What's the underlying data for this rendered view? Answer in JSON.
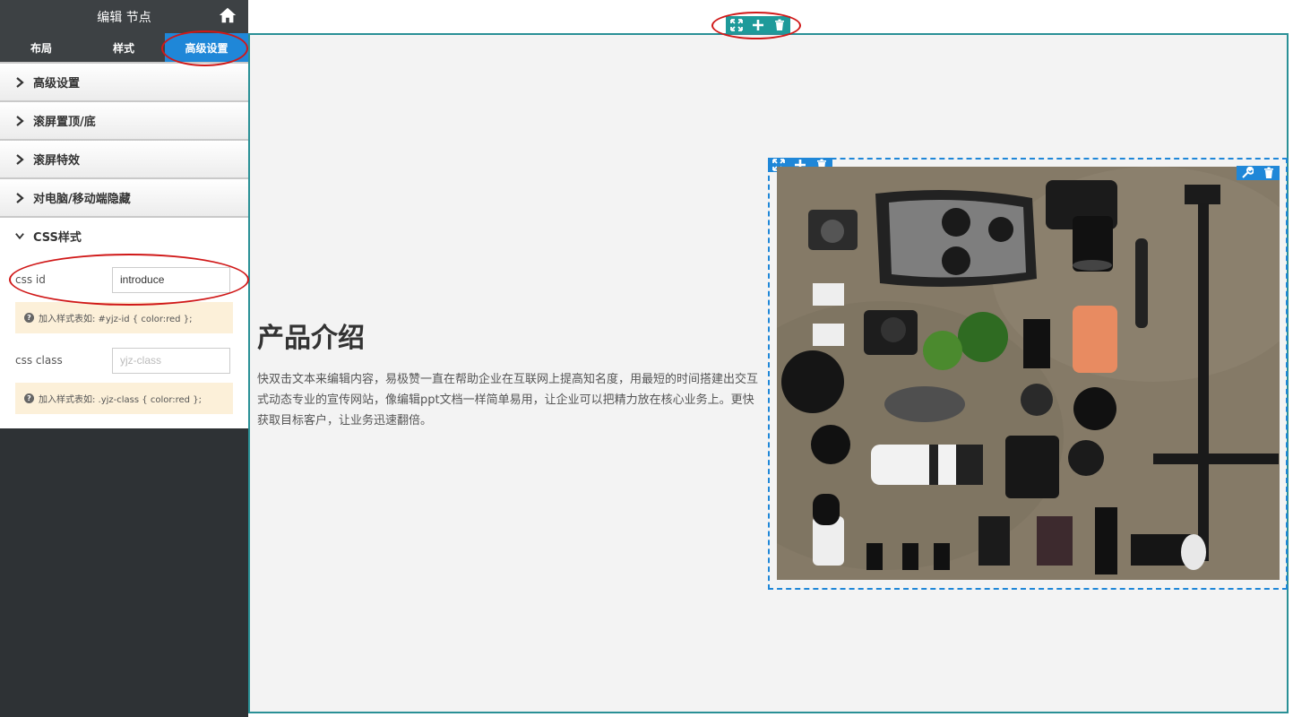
{
  "sidebar": {
    "title": "编辑 节点",
    "tabs": [
      {
        "label": "布局"
      },
      {
        "label": "样式"
      },
      {
        "label": "高级设置"
      }
    ],
    "sections": [
      {
        "label": "高级设置"
      },
      {
        "label": "滚屏置顶/底"
      },
      {
        "label": "滚屏特效"
      },
      {
        "label": "对电脑/移动端隐藏"
      }
    ],
    "css_section": {
      "label": "CSS样式",
      "css_id_label": "css id",
      "css_id_value": "introduce",
      "css_id_hint": "加入样式表如: #yjz-id { color:red };",
      "css_class_label": "css class",
      "css_class_placeholder": "yjz-class",
      "css_class_hint": "加入样式表如: .yjz-class { color:red };"
    }
  },
  "content": {
    "title": "产品介绍",
    "description": "快双击文本来编辑内容，易极赞一直在帮助企业在互联网上提高知名度，用最短的时间搭建出交互式动态专业的宣传网站，像编辑ppt文档一样简单易用，让企业可以把精力放在核心业务上。更快获取目标客户，让业务迅速翻倍。"
  },
  "colors": {
    "accent": "#1f87d8",
    "teal": "#1e9a9a",
    "annotation": "#d01818",
    "hint_bg": "#fcf0d9"
  },
  "icons": [
    "home-icon",
    "chevron-right-icon",
    "chevron-down-icon",
    "question-icon",
    "expand-icon",
    "plus-icon",
    "trash-icon",
    "wrench-icon"
  ]
}
